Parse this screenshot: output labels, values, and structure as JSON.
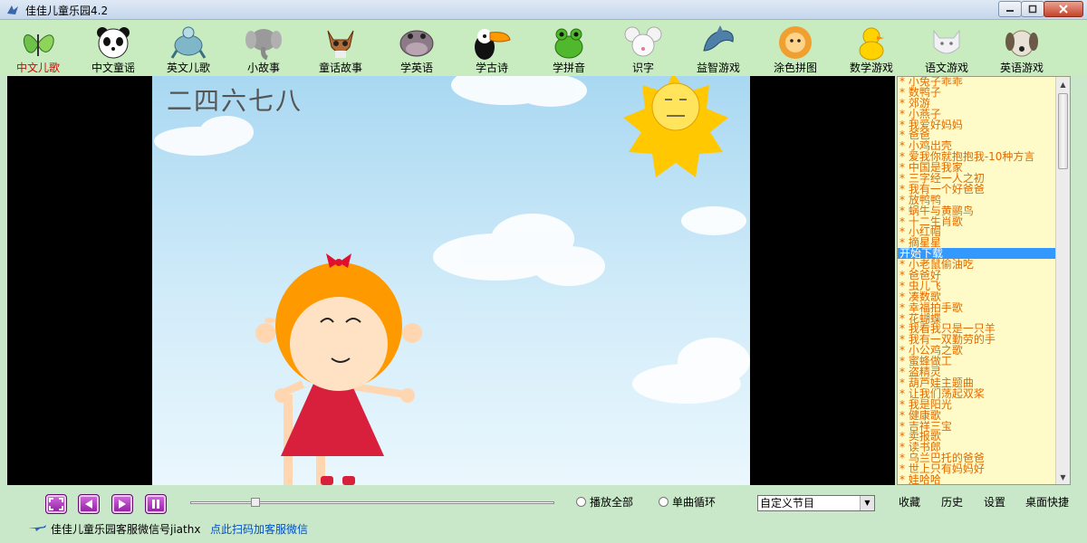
{
  "window": {
    "title": "佳佳儿童乐园4.2",
    "controls": {
      "minimize": "—",
      "maximize": "▢",
      "close": "✕"
    }
  },
  "toolbar": {
    "active_index": 0,
    "items": [
      {
        "label": "中文儿歌",
        "icon": "butterfly-icon"
      },
      {
        "label": "中文童谣",
        "icon": "panda-icon"
      },
      {
        "label": "英文儿歌",
        "icon": "turtle-icon"
      },
      {
        "label": "小故事",
        "icon": "elephant-icon"
      },
      {
        "label": "童话故事",
        "icon": "raccoon-icon"
      },
      {
        "label": "学英语",
        "icon": "hippo-icon"
      },
      {
        "label": "学古诗",
        "icon": "toucan-icon"
      },
      {
        "label": "学拼音",
        "icon": "frog-icon"
      },
      {
        "label": "识字",
        "icon": "mouse-icon"
      },
      {
        "label": "益智游戏",
        "icon": "dolphin-icon"
      },
      {
        "label": "涂色拼图",
        "icon": "lion-icon"
      },
      {
        "label": "数学游戏",
        "icon": "duck-icon"
      },
      {
        "label": "语文游戏",
        "icon": "cat-icon"
      },
      {
        "label": "英语游戏",
        "icon": "dog-icon"
      }
    ]
  },
  "player": {
    "lyric": "二四六七八"
  },
  "playlist": {
    "selected_index": 16,
    "items": [
      "* 小兔子乖乖",
      "* 数鸭子",
      "* 郊游",
      "* 小燕子",
      "* 我爱好妈妈",
      "* 爸爸",
      "* 小鸡出壳",
      "* 爱我你就抱抱我-10种方言",
      "* 中国是我家",
      "* 三字经一人之初",
      "* 我有一个好爸爸",
      "* 放鸭鸭",
      "* 蜗牛与黄鹂鸟",
      "* 十二生肖歌",
      "* 小红帽",
      "* 摘星星",
      "开始下载",
      "* 小老鼠偷油吃",
      "* 爸爸好",
      "* 虫儿飞",
      "* 凑数歌",
      "* 幸福拍手歌",
      "* 花蝴蝶",
      "* 我看我只是一只羊",
      "* 我有一双勤劳的手",
      "* 小公鸡之歌",
      "* 蜜蜂做工",
      "* 盗精灵",
      "* 葫芦娃主题曲",
      "* 让我们荡起双桨",
      "* 我是阳光",
      "* 健康歌",
      "* 吉祥三宝",
      "* 卖报歌",
      "* 读书郎",
      "* 乌兰巴托的爸爸",
      "* 世上只有妈妈好",
      "* 娃哈哈"
    ]
  },
  "controls": {
    "buttons": [
      "fullscreen-button",
      "previous-button",
      "next-button",
      "pause-button"
    ],
    "seek_progress": 0.17,
    "radio_play_all": "播放全部",
    "radio_single_loop": "单曲循环",
    "program_select": "自定义节目",
    "favorites": "收藏",
    "history": "历史",
    "settings": "设置",
    "desktop_shortcut": "桌面快捷",
    "footer_note": "佳佳儿童乐园客服微信号jiathx",
    "footer_link": "点此扫码加客服微信"
  },
  "colors": {
    "active_tab": "#e00000",
    "playlist_bg": "#fffbc8",
    "playlist_text": "#e06b00",
    "selection": "#3399ff",
    "control_button": "#a02fb3",
    "window_bg": "#c9e8c9"
  }
}
